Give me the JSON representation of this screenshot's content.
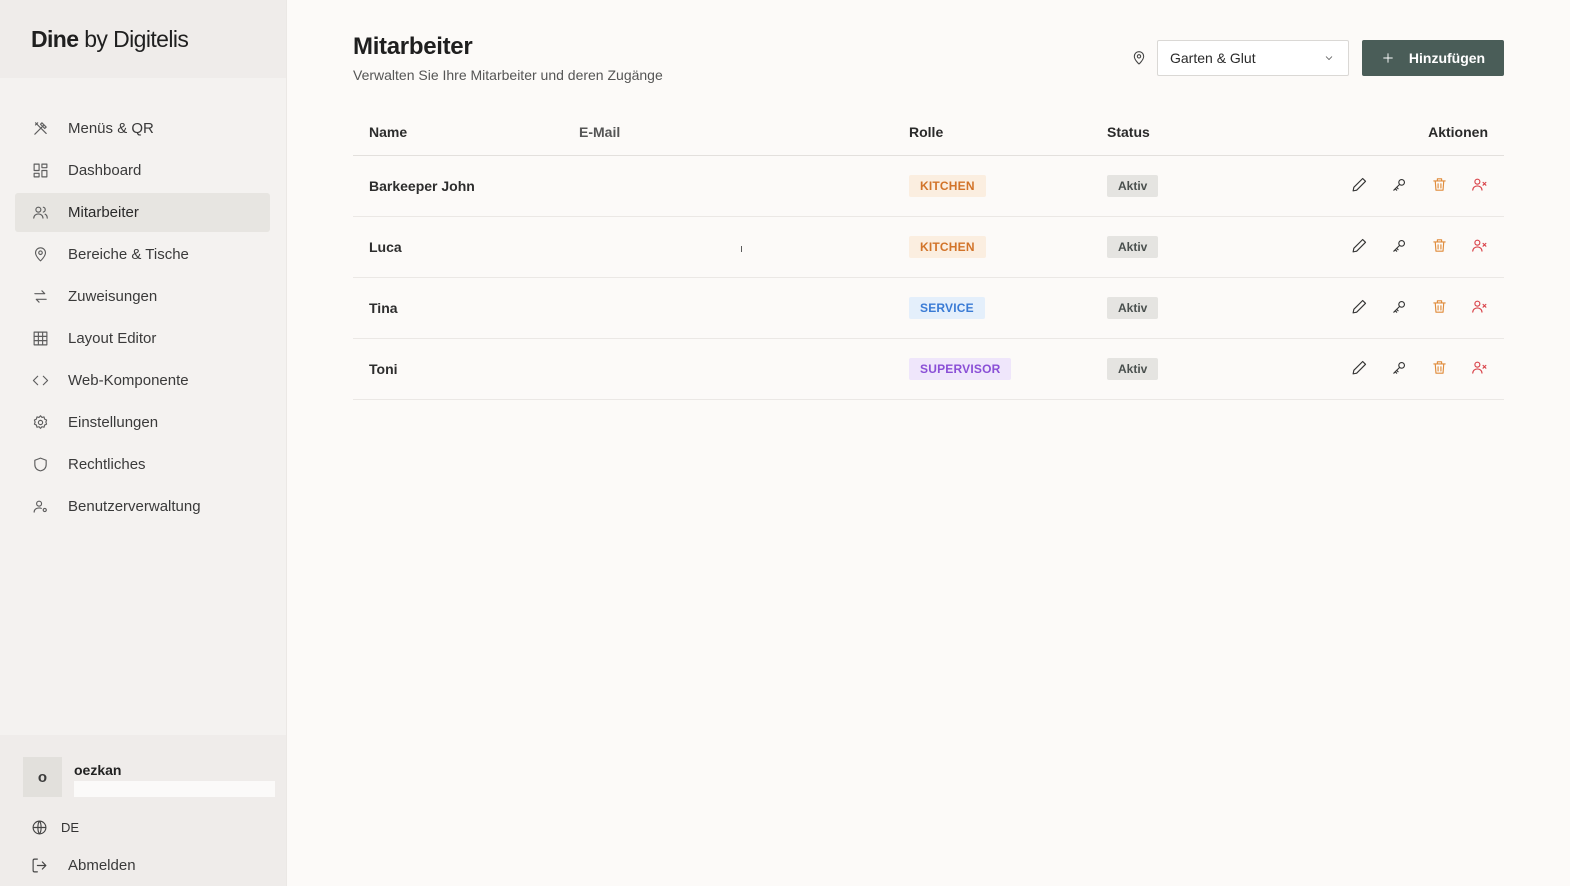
{
  "brand": {
    "name_bold": "Dine",
    "name_regular": " by Digitelis"
  },
  "sidebar": {
    "items": [
      {
        "label": "Menüs & QR",
        "icon": "utensils-icon",
        "active": false
      },
      {
        "label": "Dashboard",
        "icon": "dashboard-icon",
        "active": false
      },
      {
        "label": "Mitarbeiter",
        "icon": "users-icon",
        "active": true
      },
      {
        "label": "Bereiche & Tische",
        "icon": "map-pin-icon",
        "active": false
      },
      {
        "label": "Zuweisungen",
        "icon": "arrows-swap-icon",
        "active": false
      },
      {
        "label": "Layout Editor",
        "icon": "grid-icon",
        "active": false
      },
      {
        "label": "Web-Komponente",
        "icon": "code-icon",
        "active": false
      },
      {
        "label": "Einstellungen",
        "icon": "gear-icon",
        "active": false
      },
      {
        "label": "Rechtliches",
        "icon": "shield-icon",
        "active": false
      },
      {
        "label": "Benutzerverwaltung",
        "icon": "user-cog-icon",
        "active": false
      }
    ],
    "user": {
      "initial": "o",
      "name": "oezkan"
    },
    "language": "DE",
    "logout_label": "Abmelden"
  },
  "header": {
    "title": "Mitarbeiter",
    "subtitle": "Verwalten Sie Ihre Mitarbeiter und deren Zugänge",
    "location_select": "Garten & Glut",
    "add_label": "Hinzufügen"
  },
  "table": {
    "columns": {
      "name": "Name",
      "email": "E-Mail",
      "role": "Rolle",
      "status": "Status",
      "actions": "Aktionen"
    },
    "rows": [
      {
        "name": "Barkeeper John",
        "email": "",
        "role": "KITCHEN",
        "status": "Aktiv"
      },
      {
        "name": "Luca",
        "email": "ı",
        "role": "KITCHEN",
        "status": "Aktiv"
      },
      {
        "name": "Tina",
        "email": "",
        "role": "SERVICE",
        "status": "Aktiv"
      },
      {
        "name": "Toni",
        "email": "",
        "role": "SUPERVISOR",
        "status": "Aktiv"
      }
    ]
  },
  "colors": {
    "accent": "#4a5d58",
    "kitchen_bg": "#fbeee0",
    "kitchen_fg": "#d2742a",
    "service_bg": "#e4effb",
    "service_fg": "#3a7bd5",
    "supervisor_bg": "#efe6fb",
    "supervisor_fg": "#8a4fd6",
    "edit": "#333333",
    "key": "#333333",
    "delete": "#e08b3a",
    "remove": "#d9434a"
  }
}
